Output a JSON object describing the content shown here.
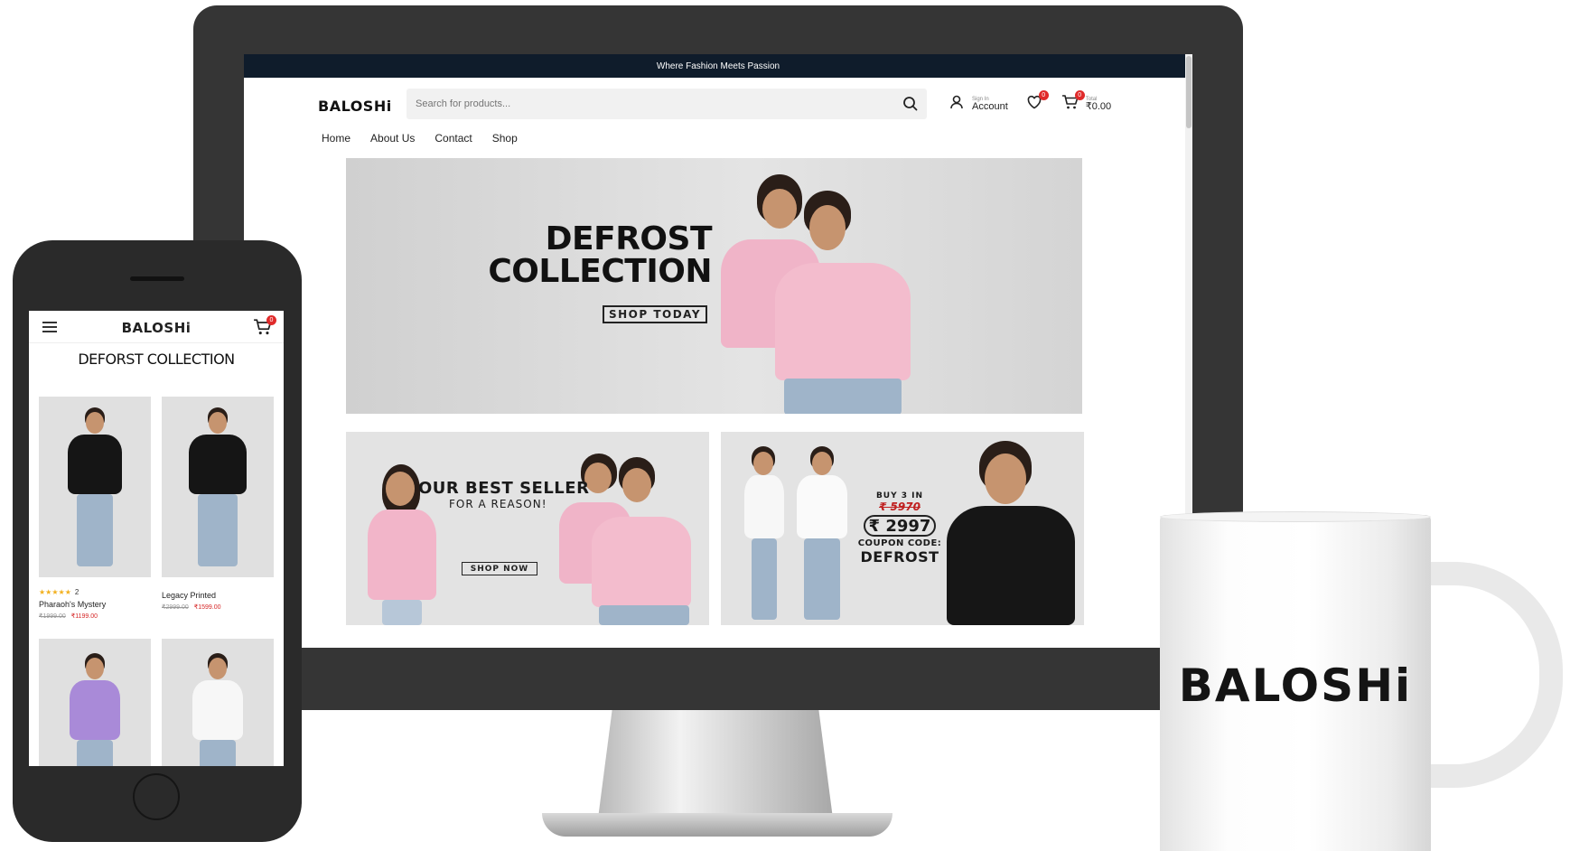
{
  "desktop": {
    "announcement": "Where Fashion Meets Passion",
    "logo": "BALOSHi",
    "search": {
      "placeholder": "Search for products..."
    },
    "account": {
      "small": "Sign In",
      "label": "Account"
    },
    "wishlist_count": "0",
    "cart": {
      "count": "0",
      "small": "Total",
      "total": "₹0.00"
    },
    "nav": [
      "Home",
      "About Us",
      "Contact",
      "Shop"
    ],
    "hero": {
      "line1": "DEFROST",
      "line2": "COLLECTION",
      "button": "SHOP TODAY"
    },
    "promo_best": {
      "title": "OUR BEST SELLER",
      "subtitle": "FOR A REASON!",
      "button": "SHOP NOW"
    },
    "promo_offer": {
      "buy": "BUY 3 IN",
      "old_price": "₹ 5970",
      "price": "₹ 2997",
      "coupon_label": "COUPON CODE:",
      "coupon_code": "DEFROST"
    }
  },
  "mobile": {
    "logo": "BALOSHi",
    "cart_count": "0",
    "title": "DEFORST COLLECTION",
    "products": [
      {
        "stars": "★★★★★",
        "reviews": "2",
        "name": "Pharaoh's Mystery",
        "old_price": "₹1999.00",
        "price": "₹1199.00"
      },
      {
        "stars": "",
        "reviews": "",
        "name": "Legacy Printed",
        "old_price": "₹2999.00",
        "price": "₹1599.00"
      }
    ]
  },
  "mug": {
    "logo": "BALOSHi"
  },
  "colors": {
    "announce_bg": "#0f1c2b",
    "badge": "#e02b2b",
    "sale": "#d62828",
    "star": "#f2b01e",
    "device": "#353535"
  }
}
